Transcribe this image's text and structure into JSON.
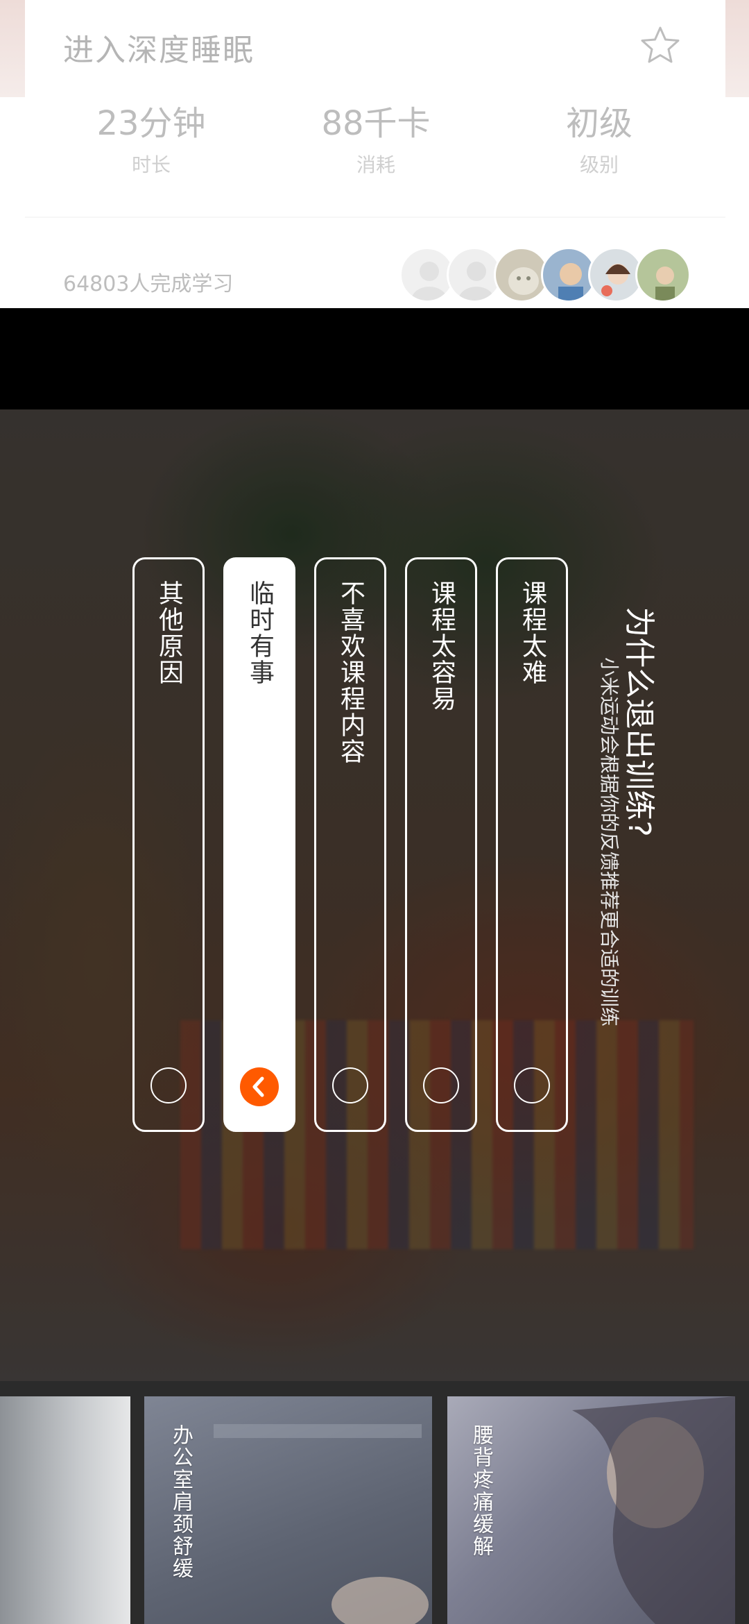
{
  "course": {
    "title": "进入深度睡眠",
    "stats": [
      {
        "value": "23分钟",
        "label": "时长"
      },
      {
        "value": "88千卡",
        "label": "消耗"
      },
      {
        "value": "初级",
        "label": "级别"
      }
    ],
    "learners_text": "64803人完成学习",
    "favorite_icon": "star-icon"
  },
  "exit_survey": {
    "question": "为什么退出训练?",
    "subtitle": "小米运动会根据你的反馈推荐更合适的训练",
    "options": [
      {
        "label": "课程太难",
        "selected": false
      },
      {
        "label": "课程太容易",
        "selected": false
      },
      {
        "label": "不喜欢课程内容",
        "selected": false
      },
      {
        "label": "临时有事",
        "selected": true
      },
      {
        "label": "其他原因",
        "selected": false
      }
    ],
    "accent_color": "#ff5a00"
  },
  "recommendations": [
    {
      "label": "腰背疼痛缓解"
    },
    {
      "label": "办公室肩颈舒缓"
    },
    {
      "label": ""
    }
  ]
}
